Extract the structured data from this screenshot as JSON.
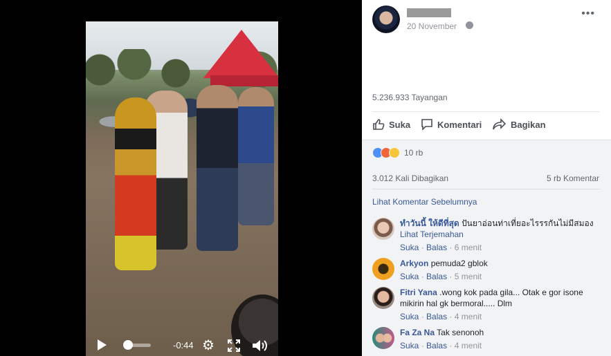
{
  "video": {
    "time_remaining": "-0:44",
    "progress_fraction": 0.05,
    "icons": [
      "play-icon",
      "settings-gear-icon",
      "fullscreen-icon",
      "volume-icon"
    ]
  },
  "post": {
    "date": "20 November",
    "views": "5.236.933 Tayangan",
    "actions": {
      "like": "Suka",
      "comment": "Komentari",
      "share": "Bagikan"
    },
    "reactions_count": "10 rb",
    "shares": "3.012 Kali Dibagikan",
    "comments_count": "5 rb Komentar",
    "view_previous": "Lihat Komentar Sebelumnya"
  },
  "comments": [
    {
      "name": "ทำวันนี้ ให้ดีที่สุด",
      "text": "ปันยาอ่อนท่าเที่ยอะไรรรกันไม่มีสมอง",
      "translate": "Lihat Terjemahan",
      "like": "Suka",
      "reply": "Balas",
      "time": "6 menit"
    },
    {
      "name": "Arkyon",
      "text": "pemuda2 gblok",
      "like": "Suka",
      "reply": "Balas",
      "time": "5 menit"
    },
    {
      "name": "Fitri Yana",
      "text": ".wong kok pada gila... Otak e gor isone mikirin hal gk bermoral..... Dlm",
      "like": "Suka",
      "reply": "Balas",
      "time": "4 menit"
    },
    {
      "name": "Fa Za Na",
      "text": "Tak senonoh",
      "like": "Suka",
      "reply": "Balas",
      "time": "4 menit"
    }
  ],
  "colors": {
    "link": "#385898",
    "meta": "#90949c",
    "panel_bg": "#f2f3f5"
  }
}
